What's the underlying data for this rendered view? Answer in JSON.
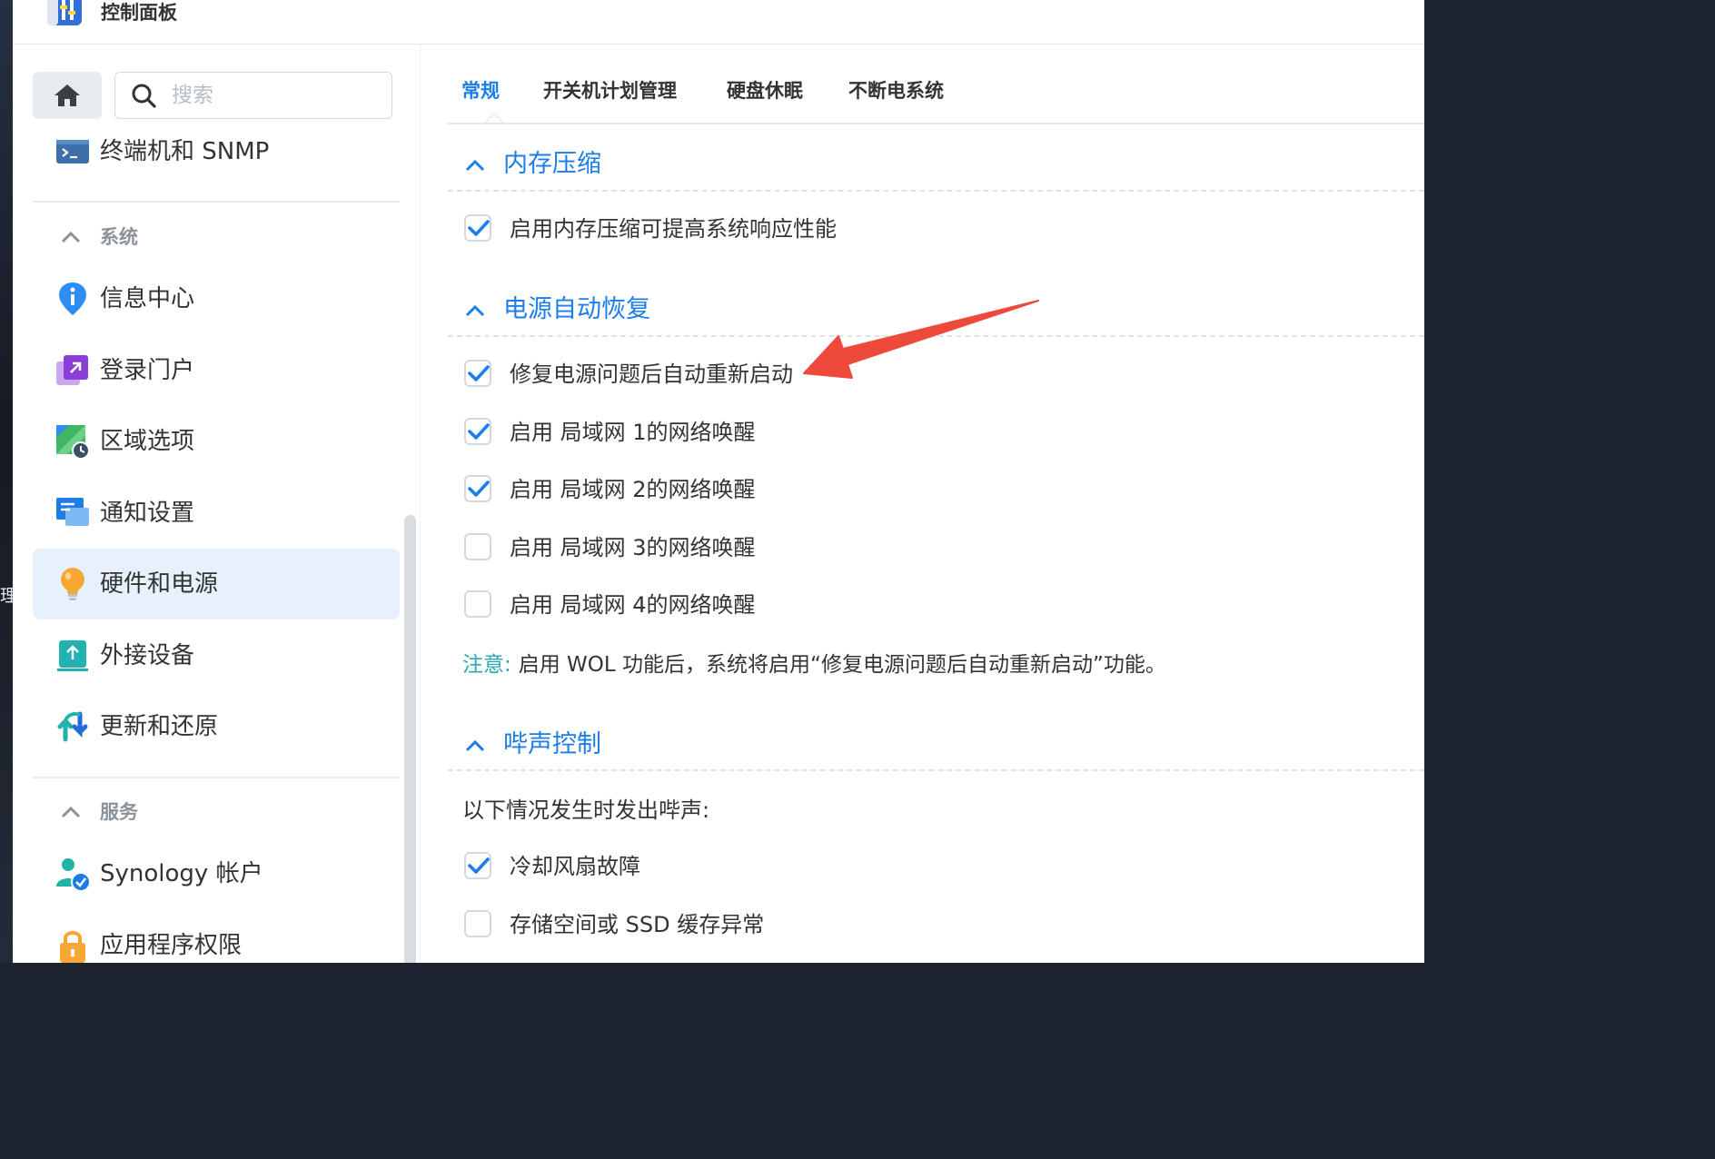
{
  "desktop": {
    "edge_text": "理"
  },
  "window": {
    "title": "控制面板",
    "app_icon": "control-panel-icon"
  },
  "sidebar": {
    "home_icon": "home-icon",
    "search": {
      "placeholder": "搜索",
      "value": ""
    },
    "top_item": {
      "label": "终端机和 SNMP",
      "icon": "terminal-icon"
    },
    "sections": [
      {
        "label": "系统",
        "items": [
          {
            "label": "信息中心",
            "icon": "info-icon"
          },
          {
            "label": "登录门户",
            "icon": "login-portal-icon"
          },
          {
            "label": "区域选项",
            "icon": "regional-options-icon"
          },
          {
            "label": "通知设置",
            "icon": "notification-icon"
          },
          {
            "label": "硬件和电源",
            "icon": "lightbulb-icon",
            "active": true
          },
          {
            "label": "外接设备",
            "icon": "external-devices-icon"
          },
          {
            "label": "更新和还原",
            "icon": "update-restore-icon"
          }
        ]
      },
      {
        "label": "服务",
        "items": [
          {
            "label": "Synology 帐户",
            "icon": "synology-account-icon"
          },
          {
            "label": "应用程序权限",
            "icon": "lock-icon"
          }
        ]
      }
    ]
  },
  "main": {
    "tabs": [
      {
        "label": "常规",
        "active": true
      },
      {
        "label": "开关机计划管理"
      },
      {
        "label": "硬盘休眠"
      },
      {
        "label": "不断电系统"
      }
    ],
    "memory_compression": {
      "title": "内存压缩",
      "options": [
        {
          "label": "启用内存压缩可提高系统响应性能",
          "checked": true
        }
      ]
    },
    "power_recovery": {
      "title": "电源自动恢复",
      "options": [
        {
          "label": "修复电源问题后自动重新启动",
          "checked": true
        },
        {
          "label": "启用 局域网 1的网络唤醒",
          "checked": true
        },
        {
          "label": "启用 局域网 2的网络唤醒",
          "checked": true
        },
        {
          "label": "启用 局域网 3的网络唤醒",
          "checked": false
        },
        {
          "label": "启用 局域网 4的网络唤醒",
          "checked": false
        }
      ],
      "note_label": "注意:",
      "note_text": "启用 WOL 功能后，系统将启用“修复电源问题后自动重新启动”功能。"
    },
    "beep_control": {
      "title": "哔声控制",
      "intro": "以下情况发生时发出哔声:",
      "options": [
        {
          "label": "冷却风扇故障",
          "checked": true
        },
        {
          "label": "存储空间或 SSD 缓存异常",
          "checked": false
        }
      ]
    }
  },
  "annotation": {
    "arrow_color": "#ee4a3c",
    "points_to": "修复电源问题后自动重新启动"
  },
  "colors": {
    "accent": "#1c7ee6",
    "active_bg": "#e6f1fd",
    "note": "#26a8b6",
    "checkbox_border": "#d4d9df",
    "checkmark": "#1c7ee6"
  }
}
